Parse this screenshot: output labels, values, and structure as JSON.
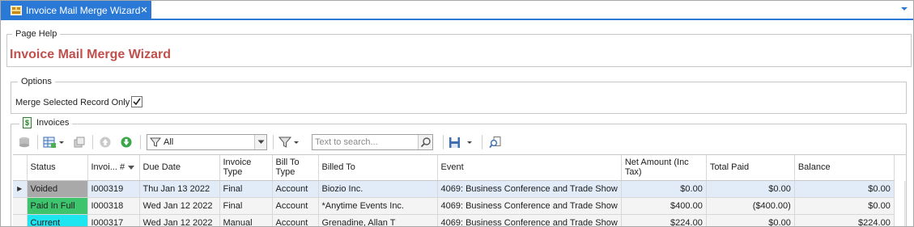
{
  "tab": {
    "title": "Invoice Mail Merge Wizard",
    "close_glyph": "✕"
  },
  "page_help": {
    "legend": "Page Help",
    "title": "Invoice Mail Merge Wizard"
  },
  "options": {
    "legend": "Options",
    "merge_selected_label": "Merge Selected Record Only",
    "merge_selected_checked": true
  },
  "invoices": {
    "legend": "Invoices",
    "filter_value": "All",
    "search_placeholder": "Text to search...",
    "columns": [
      "Status",
      "Invoi... #",
      "Due Date",
      "Invoice Type",
      "Bill To Type",
      "Billed To",
      "Event",
      "Net Amount (Inc Tax)",
      "Total Paid",
      "Balance"
    ],
    "rows": [
      {
        "status": "Voided",
        "invoice": "I000319",
        "due": "Thu Jan 13 2022",
        "inv_type": "Final",
        "bill_to_type": "Account",
        "billed_to": "Biozio Inc.",
        "event": "4069: Business Conference and Trade Show",
        "net": "$0.00",
        "paid": "$0.00",
        "balance": "$0.00"
      },
      {
        "status": "Paid In Full",
        "invoice": "I000318",
        "due": "Wed Jan 12 2022",
        "inv_type": "Final",
        "bill_to_type": "Account",
        "billed_to": "*Anytime Events Inc.",
        "event": "4069: Business Conference and Trade Show",
        "net": "$400.00",
        "paid": "($400.00)",
        "balance": "$0.00"
      },
      {
        "status": "Current",
        "invoice": "I000317",
        "due": "Wed Jan 12 2022",
        "inv_type": "Manual",
        "bill_to_type": "Account",
        "billed_to": "Grenadine, Allan T",
        "event": "4069: Business Conference and Trade Show",
        "net": "$224.00",
        "paid": "$0.00",
        "balance": "$224.00"
      }
    ]
  },
  "colors": {
    "tab_blue": "#2b79d7",
    "title_red": "#c0504d",
    "voided": "#a9a9a9",
    "paid": "#3ec46d",
    "current": "#1ee6f0"
  }
}
